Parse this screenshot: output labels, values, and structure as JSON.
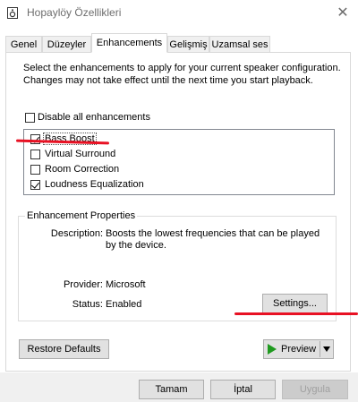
{
  "window": {
    "title": "Hopaylöy Özellikleri",
    "icon": "speaker-icon",
    "close_glyph": "✕"
  },
  "tabs": [
    {
      "label": "Genel",
      "active": false
    },
    {
      "label": "Düzeyler",
      "active": false
    },
    {
      "label": "Enhancements",
      "active": true
    },
    {
      "label": "Gelişmiş",
      "active": false
    },
    {
      "label": "Uzamsal ses",
      "active": false
    }
  ],
  "description": "Select the enhancements to apply for your current speaker configuration. Changes may not take effect until the next time you start playback.",
  "disable_all": {
    "label": "Disable all enhancements",
    "checked": false
  },
  "enhancements": [
    {
      "label": "Bass Boost",
      "checked": true,
      "focused": true
    },
    {
      "label": "Virtual Surround",
      "checked": false
    },
    {
      "label": "Room Correction",
      "checked": false
    },
    {
      "label": "Loudness Equalization",
      "checked": true
    }
  ],
  "properties": {
    "title": "Enhancement Properties",
    "description_label": "Description:",
    "description_value": "Boosts the lowest frequencies that can be played by the device.",
    "provider_label": "Provider:",
    "provider_value": "Microsoft",
    "status_label": "Status:",
    "status_value": "Enabled",
    "settings_button": "Settings..."
  },
  "restore_button": "Restore Defaults",
  "preview_button": "Preview",
  "footer": {
    "ok": "Tamam",
    "cancel": "İptal",
    "apply": "Uygula"
  },
  "colors": {
    "annotation_red": "#e81123",
    "accent": "#0078d7",
    "play_green": "#1f9a1f"
  }
}
